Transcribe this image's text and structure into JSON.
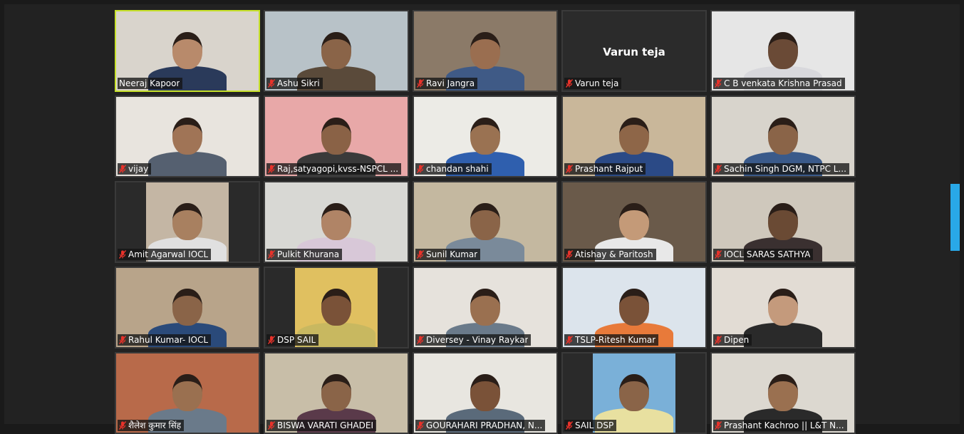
{
  "meeting": {
    "participants": [
      {
        "name": "Neeraj Kapoor",
        "muted": false,
        "active": true,
        "video": true,
        "bg": "#d9d4cc",
        "skin": "#b88a6b",
        "shirt": "#2a3a5a"
      },
      {
        "name": "Ashu Sikri",
        "muted": true,
        "video": true,
        "bg": "#b8c2c8",
        "skin": "#8a6448",
        "shirt": "#5a4a3a"
      },
      {
        "name": "Ravi Jangra",
        "muted": true,
        "video": true,
        "bg": "#8b7a68",
        "skin": "#9a6e50",
        "shirt": "#3f5a86"
      },
      {
        "name": "Varun teja",
        "muted": true,
        "video": false,
        "center_label": "Varun teja"
      },
      {
        "name": "C B venkata Krishna Prasad",
        "muted": true,
        "video": true,
        "bg": "#e6e6e6",
        "skin": "#6a4a36",
        "shirt": "#d8d8dc"
      },
      {
        "name": "vijay",
        "muted": true,
        "video": true,
        "bg": "#e8e4de",
        "skin": "#a07456",
        "shirt": "#556070"
      },
      {
        "name": "Raj,satyagopi,kvss-NSPCL ...",
        "muted": true,
        "video": true,
        "bg": "#e8a8a8",
        "skin": "#8a6246",
        "shirt": "#3a3a3a"
      },
      {
        "name": "chandan shahi",
        "muted": true,
        "video": true,
        "bg": "#ecebe6",
        "skin": "#9a7252",
        "shirt": "#2f5fae"
      },
      {
        "name": "Prashant Rajput",
        "muted": true,
        "video": true,
        "bg": "#c9b79a",
        "skin": "#8e6648",
        "shirt": "#2b4a86"
      },
      {
        "name": "Sachin Singh DGM, NTPC L...",
        "muted": true,
        "video": true,
        "bg": "#d8d4cc",
        "skin": "#8a6448",
        "shirt": "#3a5a8a"
      },
      {
        "name": "Amit Agarwal IOCL",
        "muted": true,
        "video": true,
        "bg": "#2a2a2a",
        "inner": "#c4b6a4",
        "skin": "#a88060",
        "shirt": "#e0e0e0"
      },
      {
        "name": "Pulkit Khurana",
        "muted": true,
        "video": true,
        "bg": "#d8d8d4",
        "skin": "#b08466",
        "shirt": "#d8c8d8"
      },
      {
        "name": "Sunil Kumar",
        "muted": true,
        "video": true,
        "bg": "#c4b8a0",
        "skin": "#8a6448",
        "shirt": "#7a8a9a"
      },
      {
        "name": "Atishay & Paritosh",
        "muted": true,
        "video": true,
        "bg": "#6a5a4a",
        "skin": "#c49a78",
        "shirt": "#e8e8e8"
      },
      {
        "name": "IOCL SARAS SATHYA",
        "muted": true,
        "video": true,
        "bg": "#cfc8bc",
        "skin": "#6a4a34",
        "shirt": "#3a3030"
      },
      {
        "name": "Rahul Kumar- IOCL",
        "muted": true,
        "video": true,
        "bg": "#b8a48a",
        "skin": "#8a6448",
        "shirt": "#2a4a7a"
      },
      {
        "name": "DSP SAIL",
        "muted": true,
        "video": true,
        "bg": "#2a2a2a",
        "inner": "#e0c060",
        "skin": "#7a5238",
        "shirt": "#c8b860"
      },
      {
        "name": "Diversey - Vinay Raykar",
        "muted": true,
        "video": true,
        "bg": "#e6e2dc",
        "skin": "#9a7050",
        "shirt": "#6a7a8a"
      },
      {
        "name": "TSLP-Ritesh Kumar",
        "muted": true,
        "video": true,
        "bg": "#dce4ec",
        "skin": "#7a5238",
        "shirt": "#e87a3a"
      },
      {
        "name": "Dipen",
        "muted": true,
        "video": true,
        "bg": "#e2dcd4",
        "skin": "#c49a7c",
        "shirt": "#2a2a2a"
      },
      {
        "name": "शैलेश कुमार सिंह",
        "muted": true,
        "video": true,
        "bg": "#b86a4a",
        "skin": "#9a7050",
        "shirt": "#6a7a8a"
      },
      {
        "name": "BISWA VARATI GHADEI",
        "muted": true,
        "video": true,
        "bg": "#c8bea8",
        "skin": "#8a6448",
        "shirt": "#5a3a4a"
      },
      {
        "name": "GOURAHARI PRADHAN, N...",
        "muted": true,
        "video": true,
        "bg": "#e8e6e0",
        "skin": "#7a5238",
        "shirt": "#5a6a7a"
      },
      {
        "name": "SAIL DSP",
        "muted": true,
        "video": true,
        "bg": "#2a2a2a",
        "inner": "#7ab0d8",
        "skin": "#8a6448",
        "shirt": "#e8e0a0"
      },
      {
        "name": "Prashant Kachroo || L&T N...",
        "muted": true,
        "video": true,
        "bg": "#dcd8d0",
        "skin": "#9a7050",
        "shirt": "#2a2a2a"
      }
    ]
  },
  "colors": {
    "active_border": "#c6e02a",
    "mute_icon": "#e8322a",
    "side_tab": "#29a8e8"
  }
}
